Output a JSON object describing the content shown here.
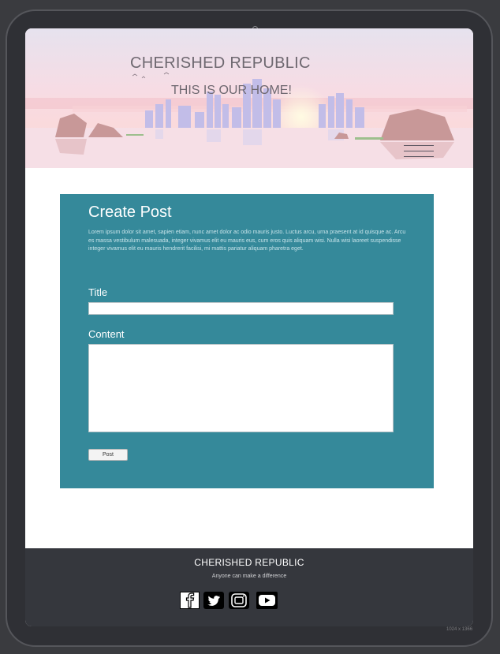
{
  "header": {
    "site_title": "CHERISHED REPUBLIC",
    "tagline": "THIS IS OUR HOME!",
    "menu_icon": "hamburger-menu-icon"
  },
  "form": {
    "heading": "Create Post",
    "description": "Lorem ipsum dolor sit amet, sapien etiam, nunc amet dolor ac odio mauris justo. Luctus arcu, urna praesent at id quisque ac. Arcu es massa vestibulum malesuada, integer vivamus elit eu mauris eus, cum eros quis aliquam wisi. Nulla wisi laoreet suspendisse integer vivamus elit eu mauris hendrerit facilisi, mi mattis pariatur aliquam pharetra eget.",
    "title_label": "Title",
    "title_value": "",
    "content_label": "Content",
    "content_value": "",
    "submit_label": "Post"
  },
  "footer": {
    "title": "CHERISHED REPUBLIC",
    "tagline": "Anyone can make a difference",
    "social": [
      "facebook-icon",
      "twitter-icon",
      "instagram-icon",
      "youtube-icon"
    ]
  },
  "viewport_label": "1024 x 1366",
  "colors": {
    "panel": "#35899a",
    "footer": "#35373d",
    "device_frame": "#2f3035"
  }
}
